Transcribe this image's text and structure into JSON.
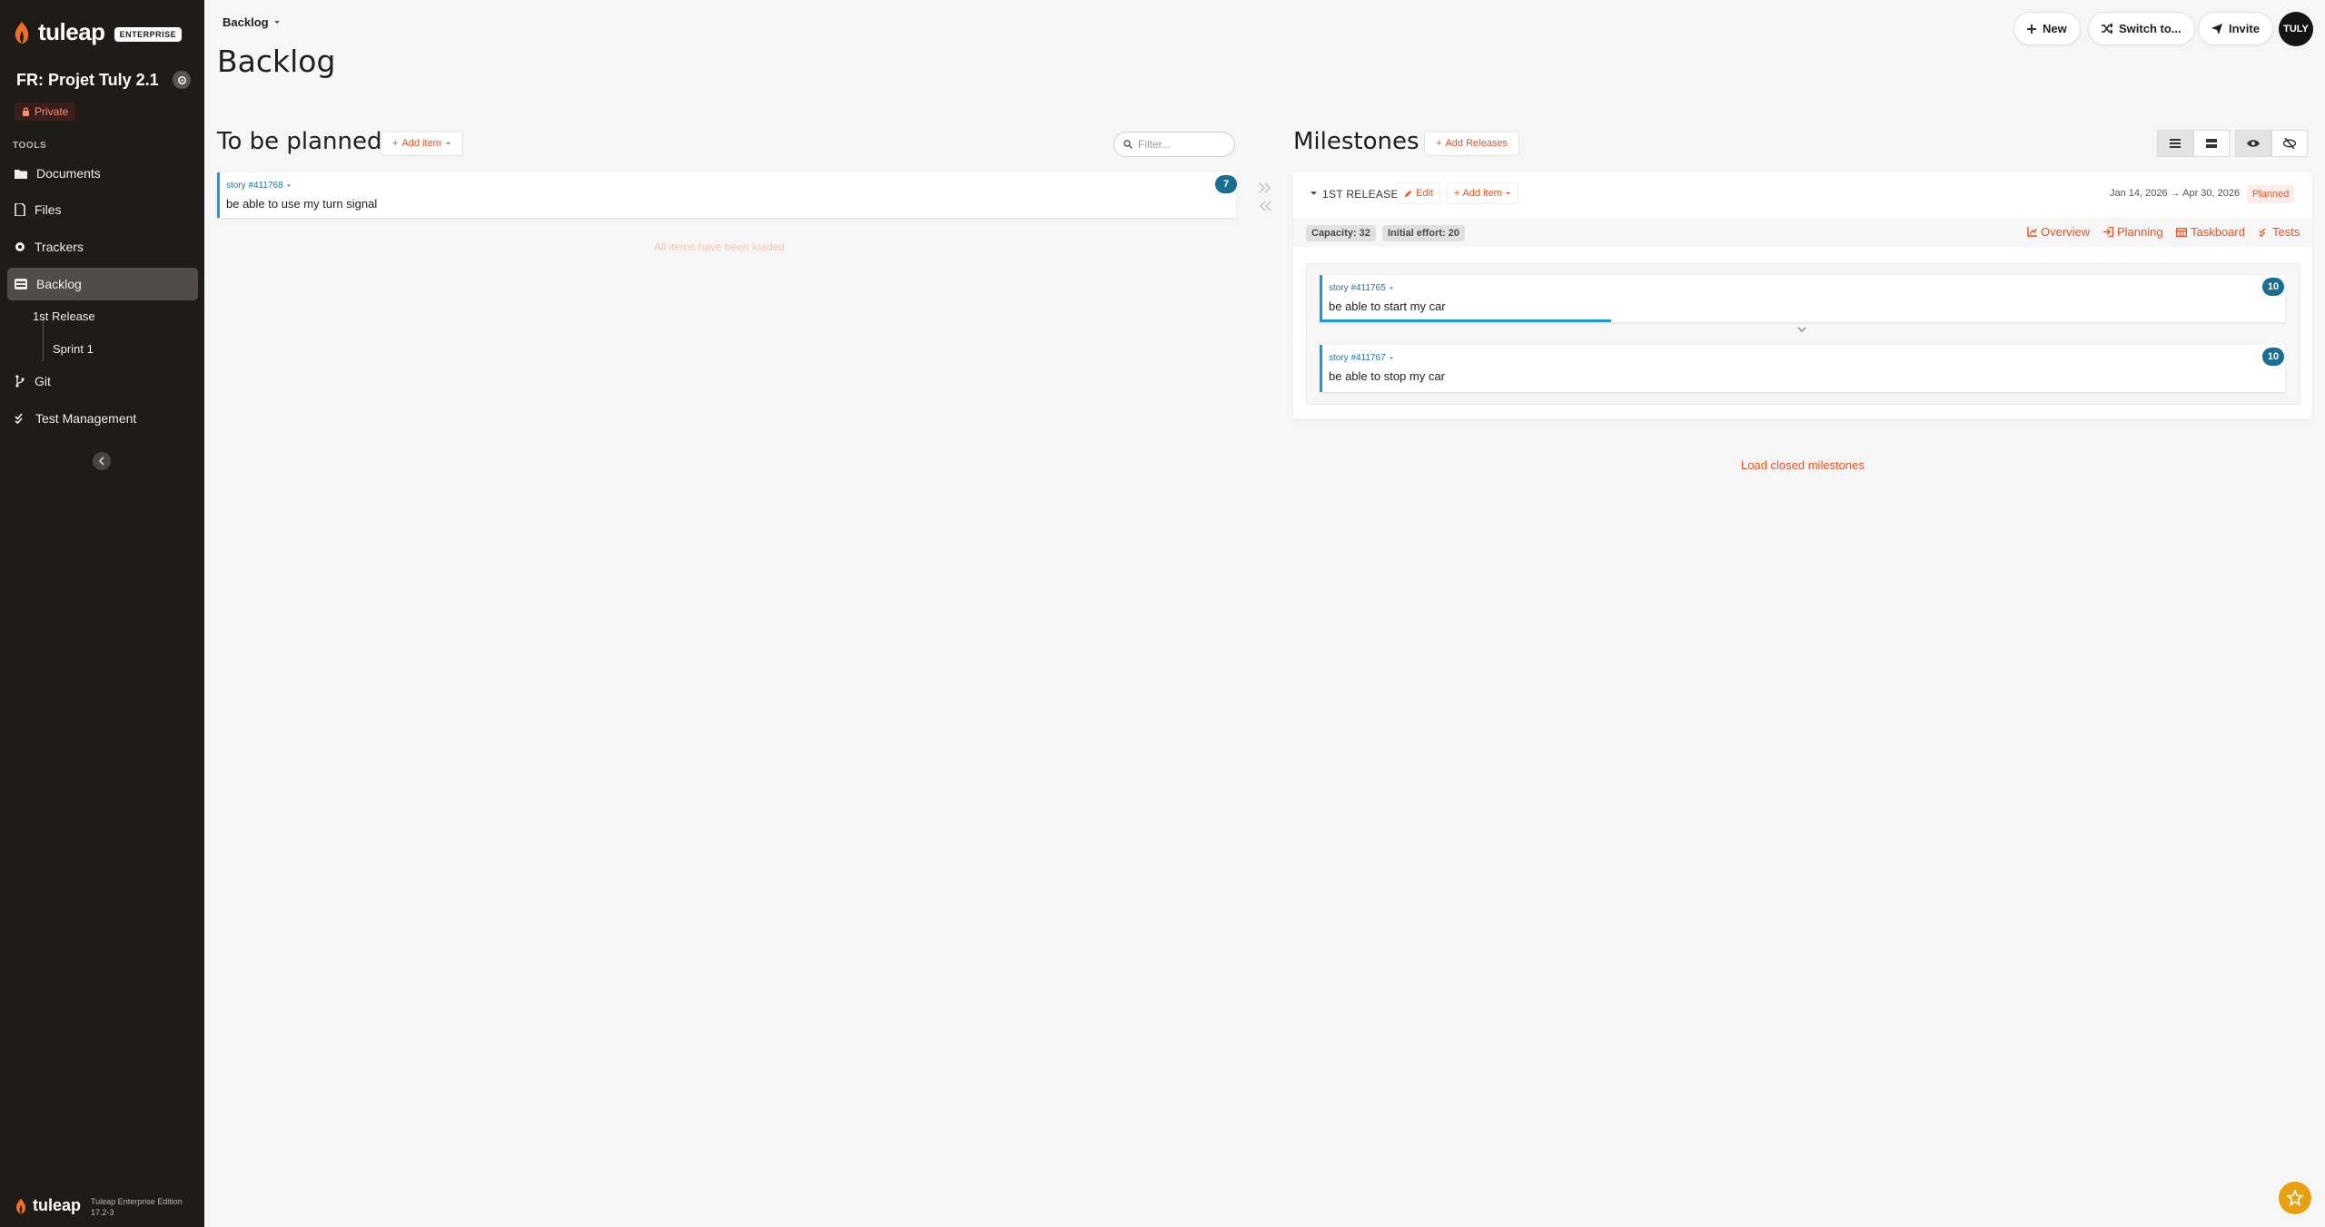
{
  "sidebar": {
    "logo_text": "tuleap",
    "logo_badge": "ENTERPRISE",
    "project_title": "FR: Projet Tuly 2.1",
    "privacy": "Private",
    "tools_label": "TOOLS",
    "items": [
      {
        "label": "Documents",
        "icon": "folder-icon"
      },
      {
        "label": "Files",
        "icon": "files-icon"
      },
      {
        "label": "Trackers",
        "icon": "trackers-icon"
      },
      {
        "label": "Backlog",
        "icon": "backlog-icon",
        "active": true
      },
      {
        "label": "Git",
        "icon": "git-icon"
      },
      {
        "label": "Test Management",
        "icon": "check-icon"
      }
    ],
    "sub_items": [
      "1st Release",
      "Sprint 1"
    ],
    "footer_logo": "tuleap",
    "footer_edition": "Tuleap Enterprise Edition",
    "footer_version": "17.2-3"
  },
  "header": {
    "breadcrumb": "Backlog",
    "page_title": "Backlog",
    "new_label": "New",
    "switch_label": "Switch to...",
    "invite_label": "Invite",
    "avatar_text": "TULY"
  },
  "to_be_planned": {
    "title": "To be planned",
    "add_item_label": "Add item",
    "filter_placeholder": "Filter...",
    "items": [
      {
        "ref": "story #411768",
        "title": "be able to use my turn signal",
        "effort": "7"
      }
    ],
    "all_loaded": "All items have been loaded"
  },
  "milestones": {
    "title": "Milestones",
    "add_releases_label": "Add Releases",
    "release": {
      "name": "1ST RELEASE",
      "edit_label": "Edit",
      "add_item_label": "Add item",
      "dates": "Jan 14, 2026 → Apr 30, 2026",
      "status": "Planned",
      "capacity": "Capacity: 32",
      "initial_effort": "Initial effort: 20",
      "links": [
        "Overview",
        "Planning",
        "Taskboard",
        "Tests"
      ],
      "items": [
        {
          "ref": "story #411765",
          "title": "be able to start my car",
          "effort": "10",
          "progress": 0.3
        },
        {
          "ref": "story #411767",
          "title": "be able to stop my car",
          "effort": "10",
          "progress": 0
        }
      ]
    },
    "load_closed": "Load closed milestones"
  },
  "colors": {
    "accent": "#f24e1e",
    "sidebar_bg": "#1e1b19",
    "card_border": "#1d99d4",
    "effort_badge": "#196e92"
  }
}
